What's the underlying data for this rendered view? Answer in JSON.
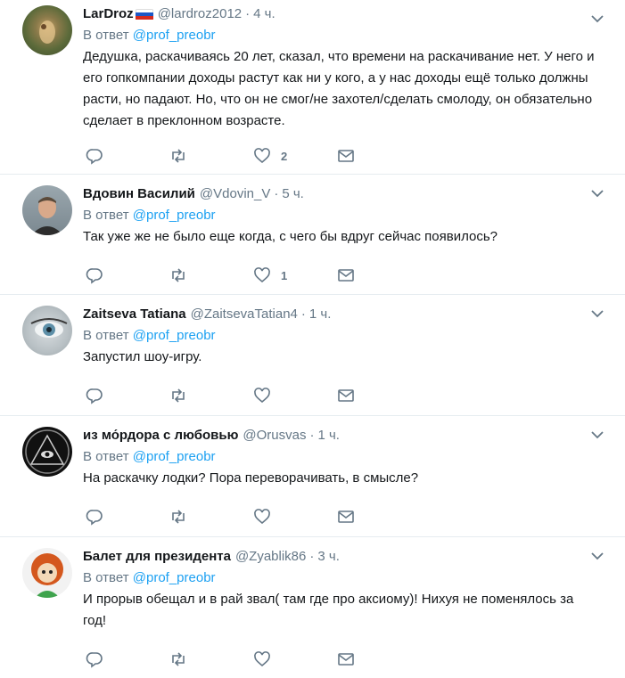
{
  "tweets": [
    {
      "name": "LarDroz",
      "flag": true,
      "handle": "@lardroz2012",
      "dot": "·",
      "time": "4 ч.",
      "reply_prefix": "В ответ ",
      "reply_mention": "@prof_preobr",
      "text": "Дедушка, раскачиваясь 20 лет, сказал, что времени на раскачивание нет. У него и его гопкомпании доходы растут как ни у кого, а у нас доходы ещё только должны расти, но падают. Но, что он не смог/не захотел/сделать смолоду, он обязательно сделает в преклонном возрасте.",
      "likes": "2"
    },
    {
      "name": "Вдовин Василий",
      "flag": false,
      "handle": "@Vdovin_V",
      "dot": "·",
      "time": "5 ч.",
      "reply_prefix": "В ответ ",
      "reply_mention": "@prof_preobr",
      "text": "Так уже же не было еще когда, с чего бы вдруг сейчас появилось?",
      "likes": "1"
    },
    {
      "name": "Zaitseva Tatiana",
      "flag": false,
      "handle": "@ZaitsevaTatian4",
      "dot": "·",
      "time": "1 ч.",
      "reply_prefix": "В ответ ",
      "reply_mention": "@prof_preobr",
      "text": "Запустил шоу-игру.",
      "likes": ""
    },
    {
      "name": "из мо́рдора с любовью",
      "flag": false,
      "handle": "@Orusvas",
      "dot": "·",
      "time": "1 ч.",
      "reply_prefix": "В ответ ",
      "reply_mention": "@prof_preobr",
      "text": "На раскачку лодки? Пора переворачивать, в смысле?",
      "likes": ""
    },
    {
      "name": "Балет для президента",
      "flag": false,
      "handle": "@Zyablik86",
      "dot": "·",
      "time": "3 ч.",
      "reply_prefix": "В ответ ",
      "reply_mention": "@prof_preobr",
      "text": "И прорыв обещал и в рай звал( там где про аксиому)! Нихуя не поменялось за год!",
      "likes": ""
    }
  ],
  "icons": {
    "reply": "reply-icon",
    "retweet": "retweet-icon",
    "like": "heart-icon",
    "message": "envelope-icon",
    "more": "chevron-down-icon"
  },
  "colors": {
    "link": "#1da1f2",
    "secondary": "#657786",
    "text": "#14171a",
    "divider": "#e6ecf0"
  }
}
